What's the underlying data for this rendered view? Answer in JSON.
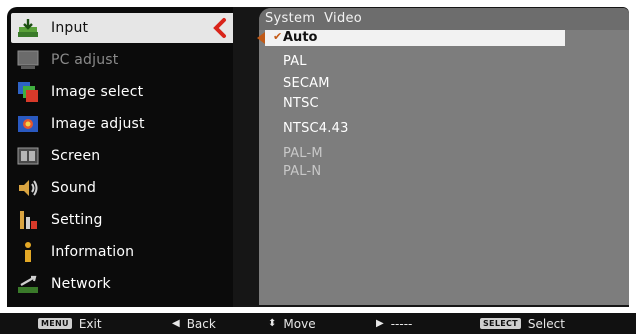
{
  "menu": {
    "items": [
      {
        "label": "Input",
        "icon": "input-icon",
        "state": "selected"
      },
      {
        "label": "PC adjust",
        "icon": "monitor-icon",
        "state": "disabled"
      },
      {
        "label": "Image select",
        "icon": "image-select-icon",
        "state": "normal"
      },
      {
        "label": "Image adjust",
        "icon": "image-adjust-icon",
        "state": "normal"
      },
      {
        "label": "Screen",
        "icon": "screen-icon",
        "state": "normal"
      },
      {
        "label": "Sound",
        "icon": "speaker-icon",
        "state": "normal"
      },
      {
        "label": "Setting",
        "icon": "setting-icon",
        "state": "normal"
      },
      {
        "label": "Information",
        "icon": "info-icon",
        "state": "normal"
      },
      {
        "label": "Network",
        "icon": "network-icon",
        "state": "normal"
      }
    ]
  },
  "panel": {
    "title": "System  Video",
    "selected_option": "Auto",
    "options": [
      {
        "label": "PAL",
        "enabled": true
      },
      {
        "label": "SECAM",
        "enabled": true
      },
      {
        "label": "NTSC",
        "enabled": true
      },
      {
        "label": "NTSC4.43",
        "enabled": true
      },
      {
        "label": "PAL-M",
        "enabled": false
      },
      {
        "label": "PAL-N",
        "enabled": false
      }
    ]
  },
  "footer": {
    "exit_key": "MENU",
    "exit": "Exit",
    "back": "Back",
    "move": "Move",
    "next": "-----",
    "select_key": "SELECT",
    "select": "Select"
  },
  "colors": {
    "accent": "#c45a16",
    "panel": "#7d7d7d",
    "menu_bg": "#0b0b0b"
  }
}
